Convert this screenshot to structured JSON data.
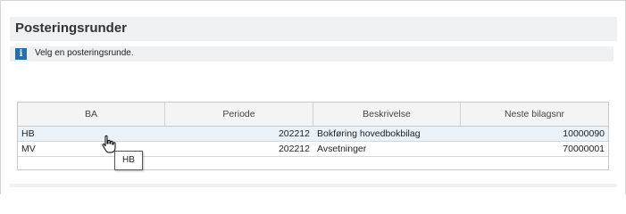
{
  "panel": {
    "title": "Posteringsrunder"
  },
  "info": {
    "icon": "info-icon",
    "message": "Velg en posteringsrunde."
  },
  "table": {
    "columns": [
      "BA",
      "Periode",
      "Beskrivelse",
      "Neste bilagsnr"
    ],
    "rows": [
      {
        "ba": "HB",
        "periode": "202212",
        "beskrivelse": "Bokføring hovedbokbilag",
        "neste_bilagsnr": "10000090"
      },
      {
        "ba": "MV",
        "periode": "202212",
        "beskrivelse": "Avsetninger",
        "neste_bilagsnr": "70000001"
      }
    ]
  },
  "tooltip": {
    "text": "HB"
  },
  "colors": {
    "title_bg": "#f0f1f2",
    "info_icon": "#2a6ea8",
    "selected_row": "#e9f2f9"
  }
}
